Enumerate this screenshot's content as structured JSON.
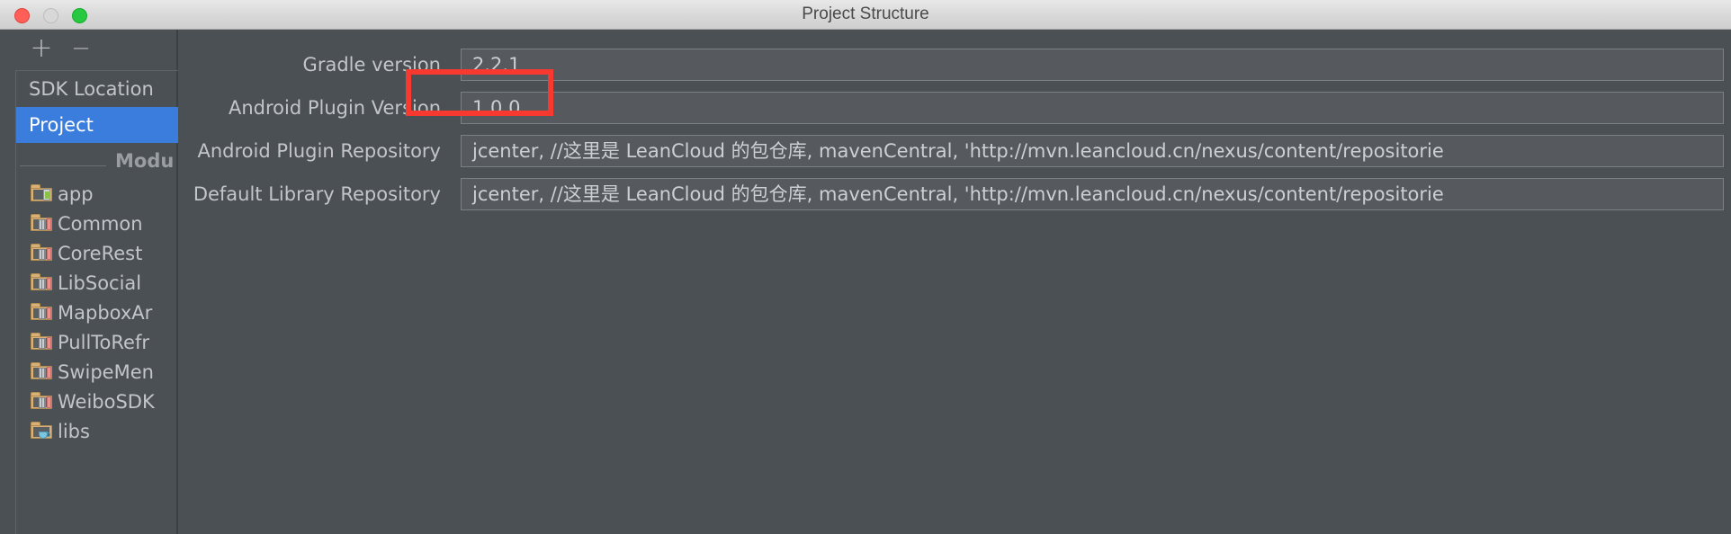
{
  "window": {
    "title": "Project Structure",
    "traffic_lights": [
      {
        "name": "close",
        "color": "#ff5f57"
      },
      {
        "name": "minimize",
        "color": "#d8d8d8"
      },
      {
        "name": "maximize",
        "color": "#28c840"
      }
    ]
  },
  "sidebar": {
    "toolbar": {
      "add_label": "+",
      "remove_label": "−"
    },
    "items": [
      {
        "label": "SDK Location",
        "selected": false
      },
      {
        "label": "Project",
        "selected": true
      }
    ],
    "group_header": "Modu",
    "modules": [
      {
        "label": "app",
        "icon": "folder-android-icon"
      },
      {
        "label": "Common",
        "icon": "folder-library-icon"
      },
      {
        "label": "CoreRest",
        "icon": "folder-library-icon"
      },
      {
        "label": "LibSocial",
        "icon": "folder-library-icon"
      },
      {
        "label": "MapboxAr",
        "icon": "folder-library-icon"
      },
      {
        "label": "PullToRefr",
        "icon": "folder-library-icon"
      },
      {
        "label": "SwipeMen",
        "icon": "folder-library-icon"
      },
      {
        "label": "WeiboSDK",
        "icon": "folder-library-icon"
      },
      {
        "label": "libs",
        "icon": "folder-java-icon"
      }
    ]
  },
  "form": {
    "rows": [
      {
        "label": "Gradle version",
        "value": "2.2.1"
      },
      {
        "label": "Android Plugin Version",
        "value": "1.0.0"
      },
      {
        "label": "Android Plugin Repository",
        "value": "jcenter, //这里是 LeanCloud 的包仓库, mavenCentral, 'http://mvn.leancloud.cn/nexus/content/repositorie"
      },
      {
        "label": "Default Library Repository",
        "value": "jcenter, //这里是 LeanCloud 的包仓库, mavenCentral, 'http://mvn.leancloud.cn/nexus/content/repositorie"
      }
    ]
  },
  "annotation": {
    "highlight_color": "#f8392f",
    "highlights_field": "Android Plugin Version"
  }
}
